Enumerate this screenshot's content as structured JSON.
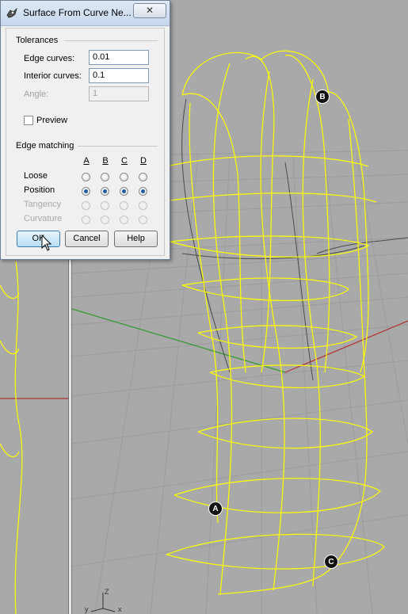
{
  "dialog": {
    "title": "Surface From Curve Ne...",
    "close_glyph": "✕",
    "tolerances": {
      "heading": "Tolerances",
      "edge_curves_label": "Edge curves:",
      "edge_curves_value": "0.01",
      "interior_curves_label": "Interior curves:",
      "interior_curves_value": "0.1",
      "angle_label": "Angle:",
      "angle_value": "1"
    },
    "preview_label": "Preview",
    "preview_checked": false,
    "edge_matching": {
      "heading": "Edge matching",
      "columns": [
        "A",
        "B",
        "C",
        "D"
      ],
      "rows": [
        {
          "label": "Loose",
          "enabled": true,
          "selected": false
        },
        {
          "label": "Position",
          "enabled": true,
          "selected": true
        },
        {
          "label": "Tangency",
          "enabled": false,
          "selected": false
        },
        {
          "label": "Curvature",
          "enabled": false,
          "selected": false
        }
      ]
    },
    "buttons": {
      "ok": "OK",
      "cancel": "Cancel",
      "help": "Help"
    }
  },
  "viewport": {
    "point_labels": [
      "A",
      "B",
      "C"
    ],
    "axis_labels": {
      "z": "Z",
      "y": "y",
      "x": "x"
    },
    "colors": {
      "background": "#a9a9a9",
      "curves": "#ffff00",
      "grid": "#9c9c9c",
      "x_axis": "#b03030",
      "y_axis": "#2e9a2e"
    }
  }
}
